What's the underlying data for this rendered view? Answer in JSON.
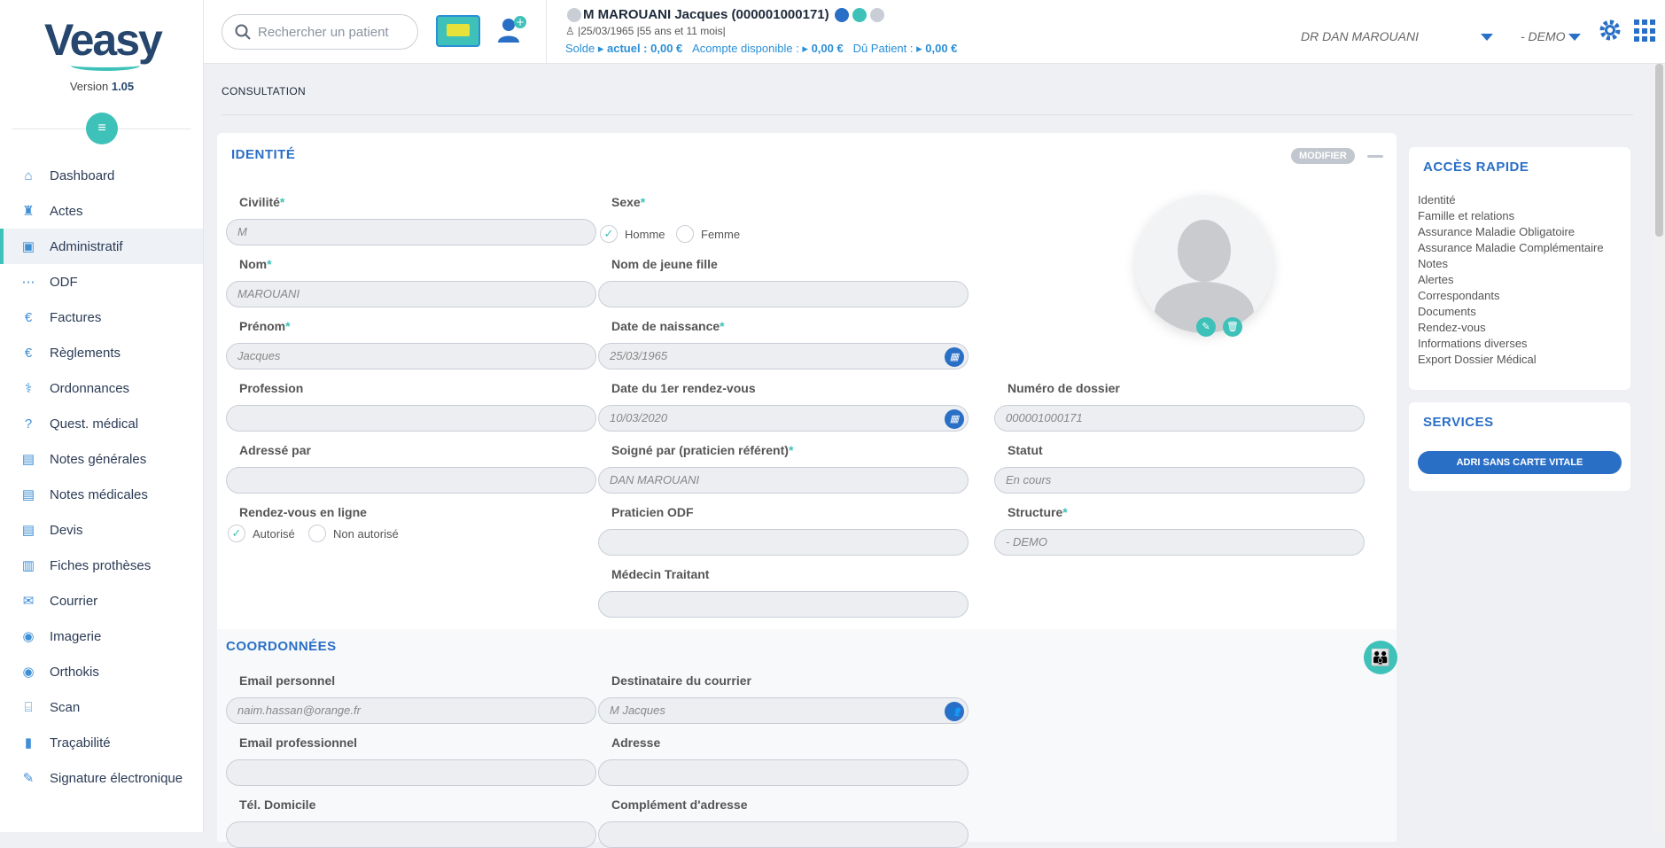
{
  "app": {
    "logo": "Veasy",
    "version_label": "Version",
    "version": "1.05"
  },
  "sidebar": {
    "items": [
      {
        "label": "Dashboard",
        "icon": "home-icon"
      },
      {
        "label": "Actes",
        "icon": "tooth-icon"
      },
      {
        "label": "Administratif",
        "icon": "id-card-icon"
      },
      {
        "label": "ODF",
        "icon": "braces-icon"
      },
      {
        "label": "Factures",
        "icon": "invoice-icon"
      },
      {
        "label": "Règlements",
        "icon": "euro-icon"
      },
      {
        "label": "Ordonnances",
        "icon": "stethoscope-icon"
      },
      {
        "label": "Quest. médical",
        "icon": "question-icon"
      },
      {
        "label": "Notes générales",
        "icon": "document-icon"
      },
      {
        "label": "Notes médicales",
        "icon": "document-icon"
      },
      {
        "label": "Devis",
        "icon": "document-icon"
      },
      {
        "label": "Fiches prothèses",
        "icon": "file-icon"
      },
      {
        "label": "Courrier",
        "icon": "envelope-icon"
      },
      {
        "label": "Imagerie",
        "icon": "camera-icon"
      },
      {
        "label": "Orthokis",
        "icon": "camera-icon"
      },
      {
        "label": "Scan",
        "icon": "scanner-icon"
      },
      {
        "label": "Traçabilité",
        "icon": "barcode-icon"
      },
      {
        "label": "Signature électronique",
        "icon": "pen-icon"
      }
    ]
  },
  "topbar": {
    "search_placeholder": "Rechercher un patient",
    "patient_name": "M MAROUANI Jacques (000001000171)",
    "patient_birth": "25/03/1965",
    "patient_age": "55 ans et 11 mois",
    "solde_label": "Solde",
    "actuel_label": "actuel : 0,00 €",
    "acompte_label": "Acompte disponible :",
    "acompte_value": "0,00 €",
    "du_label": "Dû Patient :",
    "du_value": "0,00 €",
    "doctor": "DR DAN MAROUANI",
    "structure": "- DEMO"
  },
  "breadcrumb": "CONSULTATION",
  "identite": {
    "title": "IDENTITÉ",
    "modify_label": "MODIFIER",
    "civilite_label": "Civilité",
    "civilite_value": "M",
    "sexe_label": "Sexe",
    "homme_label": "Homme",
    "femme_label": "Femme",
    "nom_label": "Nom",
    "nom_value": "MAROUANI",
    "jeune_fille_label": "Nom de jeune fille",
    "prenom_label": "Prénom",
    "prenom_value": "Jacques",
    "naissance_label": "Date de naissance",
    "naissance_value": "25/03/1965",
    "profession_label": "Profession",
    "rdv1_label": "Date du 1er rendez-vous",
    "rdv1_value": "10/03/2020",
    "dossier_label": "Numéro de dossier",
    "dossier_value": "000001000171",
    "adresse_par_label": "Adressé par",
    "soigne_label": "Soigné par (praticien référent)",
    "soigne_value": "DAN MAROUANI",
    "statut_label": "Statut",
    "statut_value": "En cours",
    "rdv_ligne_label": "Rendez-vous en ligne",
    "autorise_label": "Autorisé",
    "non_autorise_label": "Non autorisé",
    "praticien_odf_label": "Praticien ODF",
    "structure_label": "Structure",
    "structure_value": "- DEMO",
    "medecin_label": "Médecin Traitant"
  },
  "coordonnees": {
    "title": "COORDONNÉES",
    "email_perso_label": "Email personnel",
    "email_perso_value": "naim.hassan@orange.fr",
    "destinataire_label": "Destinataire du courrier",
    "destinataire_value": "M  Jacques",
    "email_pro_label": "Email professionnel",
    "adresse_label": "Adresse",
    "tel_label": "Tél. Domicile",
    "complement_label": "Complément d'adresse"
  },
  "acces_rapide": {
    "title": "ACCÈS RAPIDE",
    "links": [
      "Identité",
      "Famille et relations",
      "Assurance Maladie Obligatoire",
      "Assurance Maladie Complémentaire",
      "Notes",
      "Alertes",
      "Correspondants",
      "Documents",
      "Rendez-vous",
      "Informations diverses",
      "Export Dossier Médical"
    ]
  },
  "services": {
    "title": "SERVICES",
    "button": "ADRI SANS CARTE VITALE"
  },
  "colors": {
    "accent": "#3ec1b8",
    "primary": "#2a6fc6",
    "navy": "#26466e"
  }
}
